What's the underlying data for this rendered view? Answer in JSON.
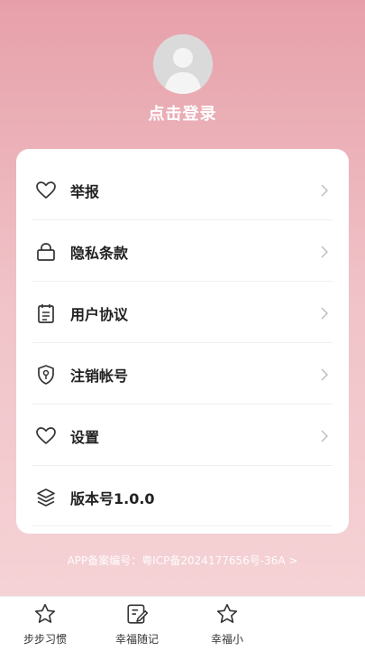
{
  "profile": {
    "login_label": "点击登录",
    "avatar_icon": "default-avatar-icon"
  },
  "menu": [
    {
      "label": "举报",
      "icon": "heart-icon"
    },
    {
      "label": "隐私条款",
      "icon": "lock-icon"
    },
    {
      "label": "用户协议",
      "icon": "document-icon"
    },
    {
      "label": "注销帐号",
      "icon": "shield-icon"
    },
    {
      "label": "设置",
      "icon": "heart-icon"
    },
    {
      "label": "版本号1.0.0",
      "icon": "layers-icon"
    }
  ],
  "footer": {
    "icp_text": "APP备案编号：粤ICP备2024177656号-36A >"
  },
  "tabbar": {
    "tabs": [
      {
        "label": "步步习惯",
        "icon": "star-icon"
      },
      {
        "label": "幸福随记",
        "icon": "edit-note-icon"
      },
      {
        "label": "幸福小",
        "icon": "star-icon"
      }
    ]
  },
  "colors": {
    "header_pink": "#e7a0a9",
    "card_bg": "#ffffff",
    "text_dark": "#222222"
  }
}
